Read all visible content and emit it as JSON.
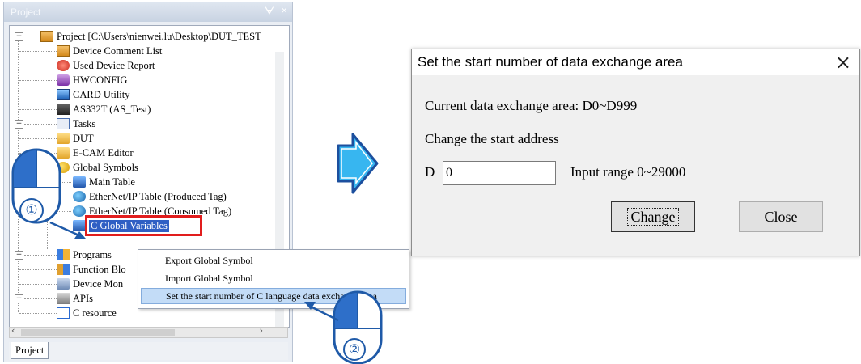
{
  "project_panel": {
    "title": "Project",
    "tab_label": "Project",
    "tree": [
      {
        "label": "Project [C:\\Users\\nienwei.lu\\Desktop\\DUT_TEST",
        "icon": "project-icon"
      },
      {
        "label": "Device Comment List",
        "icon": "comment-list-icon"
      },
      {
        "label": "Used Device Report",
        "icon": "report-icon"
      },
      {
        "label": "HWCONFIG",
        "icon": "hwconfig-icon"
      },
      {
        "label": "CARD Utility",
        "icon": "card-icon"
      },
      {
        "label": "AS332T  (AS_Test)",
        "icon": "plc-icon"
      },
      {
        "label": "Tasks",
        "icon": "tasks-icon"
      },
      {
        "label": "DUT",
        "icon": "dut-icon"
      },
      {
        "label": "E-CAM Editor",
        "icon": "ecam-icon"
      },
      {
        "label": "Global Symbols",
        "icon": "global-symbols-icon"
      },
      {
        "label": "Main Table",
        "icon": "table-icon"
      },
      {
        "label": "EtherNet/IP Table (Produced Tag)",
        "icon": "ethernet-icon"
      },
      {
        "label": "EtherNet/IP Table (Consumed Tag)",
        "icon": "ethernet-icon"
      },
      {
        "label": "C Global Variables",
        "icon": "c-global-icon"
      },
      {
        "label": "Programs",
        "icon": "programs-icon"
      },
      {
        "label": "Function Blo",
        "icon": "function-block-icon"
      },
      {
        "label": "Device Mon",
        "icon": "monitor-icon"
      },
      {
        "label": "APIs",
        "icon": "apis-icon"
      },
      {
        "label": "C resource",
        "icon": "c-resource-icon"
      }
    ]
  },
  "context_menu": {
    "items": [
      "Export Global Symbol",
      "Import Global Symbol",
      "Set the start number of C language data exchange area"
    ]
  },
  "steps": {
    "step1": "①",
    "step2": "②"
  },
  "dialog": {
    "title": "Set the start number of data exchange area",
    "close_glyph": "×",
    "current_area": "Current data exchange area: D0~D999",
    "change_start": "Change the start address",
    "prefix": "D",
    "input_value": "0",
    "range": "Input range 0~29000",
    "change_button": "Change",
    "close_button": "Close"
  },
  "colors": {
    "highlight_box": "#e11d1d",
    "arrow_fill": "#37b6f0",
    "arrow_stroke": "#1c4f9e",
    "badge_blue": "#1f5aa8"
  }
}
